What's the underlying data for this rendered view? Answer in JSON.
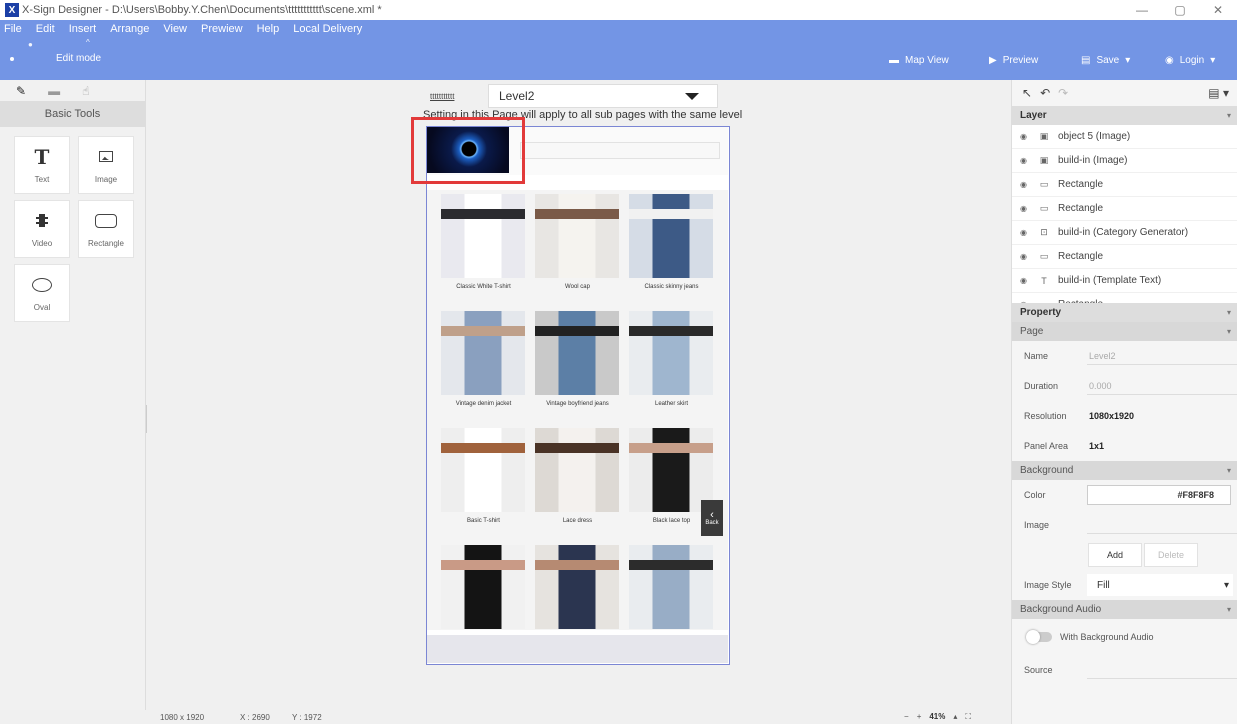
{
  "titlebar": {
    "title": "X-Sign Designer - D:\\Users\\Bobby.Y.Chen\\Documents\\ttttttttttt\\scene.xml *",
    "minimize": "—",
    "restore": "▢",
    "close": "✕"
  },
  "menu": [
    "File",
    "Edit",
    "Insert",
    "Arrange",
    "View",
    "Prewiew",
    "Help",
    "Local Delivery"
  ],
  "ribbon": {
    "edit_mode": "Edit mode",
    "map_view": "Map View",
    "preview": "Preview",
    "save": "Save",
    "login": "Login"
  },
  "left_panel": {
    "section": "Basic Tools",
    "tools": [
      {
        "label": "Text",
        "icon": "text-icon"
      },
      {
        "label": "Image",
        "icon": "image-icon"
      },
      {
        "label": "Video",
        "icon": "video-icon"
      },
      {
        "label": "Rectangle",
        "icon": "rectangle-icon"
      },
      {
        "label": "Oval",
        "icon": "oval-icon"
      }
    ]
  },
  "canvas": {
    "level_label": "ttttttttttt",
    "level_value": "Level2",
    "note": "Setting in this Page will apply to all sub pages with the same level",
    "products": [
      {
        "name": "Classic White T-shirt",
        "colors": [
          "#e9e9ef",
          "#ffffff",
          "#2b2b2f"
        ]
      },
      {
        "name": "Wool cap",
        "colors": [
          "#e8e6e3",
          "#f5f3ef",
          "#7a5a48"
        ]
      },
      {
        "name": "Classic skinny jeans",
        "colors": [
          "#d5dce6",
          "#3d5a86",
          "#f1f1f1"
        ]
      },
      {
        "name": "Vintage denim jacket",
        "colors": [
          "#e4e7ec",
          "#8aa0bf",
          "#bfa08a"
        ]
      },
      {
        "name": "Vintage boyfriend jeans",
        "colors": [
          "#c9c9c9",
          "#5c7fa6",
          "#222222"
        ]
      },
      {
        "name": "Leather skirt",
        "colors": [
          "#e9ecef",
          "#9fb6cf",
          "#2a2a2a"
        ]
      },
      {
        "name": "Basic T-shirt",
        "colors": [
          "#eeeeee",
          "#ffffff",
          "#a0623c"
        ]
      },
      {
        "name": "Lace dress",
        "colors": [
          "#ddd9d4",
          "#f4f1ee",
          "#4a3326"
        ]
      },
      {
        "name": "Black lace top",
        "colors": [
          "#ececec",
          "#1a1a1a",
          "#c79f8a"
        ]
      },
      {
        "name": "",
        "colors": [
          "#f1f1f1",
          "#141414",
          "#c99a86"
        ]
      },
      {
        "name": "",
        "colors": [
          "#e6e3df",
          "#2b3550",
          "#b68a72"
        ]
      },
      {
        "name": "",
        "colors": [
          "#e9ecef",
          "#98adc6",
          "#2c2c2c"
        ]
      }
    ],
    "back_label": "Back"
  },
  "right_panel": {
    "layer_header": "Layer",
    "layers": [
      {
        "name": "object 5 (Image)",
        "icon": "image-icon"
      },
      {
        "name": "build-in (Image)",
        "icon": "image-icon"
      },
      {
        "name": "Rectangle",
        "icon": "rectangle-icon"
      },
      {
        "name": "Rectangle",
        "icon": "rectangle-icon"
      },
      {
        "name": "build-in (Category Generator)",
        "icon": "generator-icon"
      },
      {
        "name": "Rectangle",
        "icon": "rectangle-icon"
      },
      {
        "name": "build-in (Template Text)",
        "icon": "text-icon"
      },
      {
        "name": "Rectangle",
        "icon": "rectangle-icon"
      }
    ],
    "property_header": "Property",
    "page_header": "Page",
    "name_label": "Name",
    "name_value": "Level2",
    "duration_label": "Duration",
    "duration_value": "0.000",
    "resolution_label": "Resolution",
    "resolution_value": "1080x1920",
    "panel_area_label": "Panel Area",
    "panel_area_value": "1x1",
    "background_header": "Background",
    "color_label": "Color",
    "color_value": "#F8F8F8",
    "image_label": "Image",
    "add_label": "Add",
    "delete_label": "Delete",
    "image_style_label": "Image Style",
    "image_style_value": "Fill",
    "bg_audio_header": "Background Audio",
    "with_audio_label": "With Background Audio",
    "source_label": "Source"
  },
  "statusbar": {
    "resolution": "1080 x 1920",
    "x": "X : 2690",
    "y": "Y : 1972",
    "zoom_out": "−",
    "zoom_in": "+",
    "zoom": "41%"
  }
}
